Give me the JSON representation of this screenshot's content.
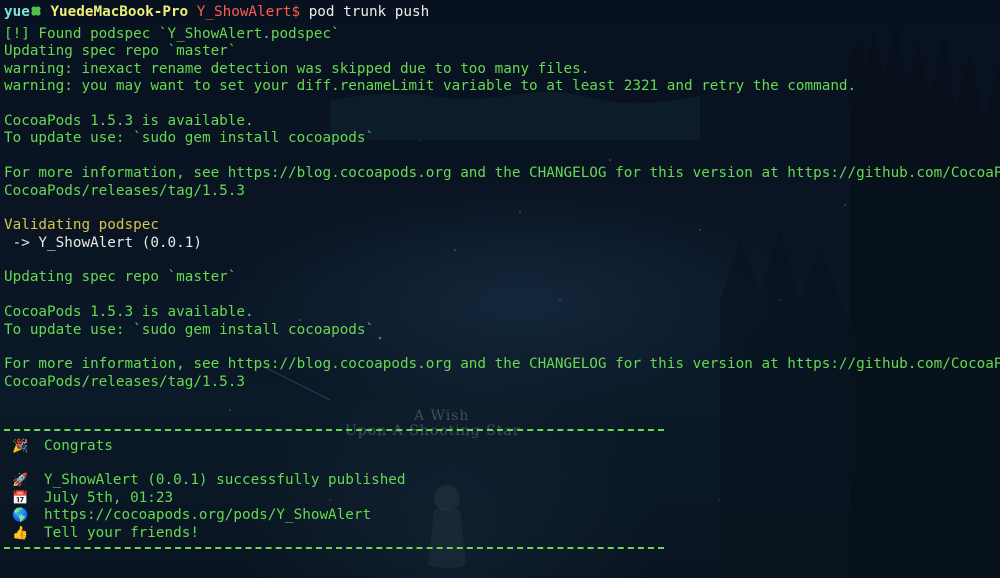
{
  "prompt": {
    "user": "yue",
    "host": "YuedeMacBook-Pro",
    "path": "Y_ShowAlert",
    "dollar": "$",
    "command": "pod trunk push"
  },
  "output": {
    "found": "[!] Found podspec `Y_ShowAlert.podspec`",
    "updating1": "Updating spec repo `master`",
    "warn1": "warning: inexact rename detection was skipped due to too many files.",
    "warn2": "warning: you may want to set your diff.renameLimit variable to at least 2321 and retry the command.",
    "available1": "CocoaPods 1.5.3 is available.",
    "update_cmd1": "To update use: `sudo gem install cocoapods`",
    "info1_a": "For more information, see https://blog.cocoapods.org and the CHANGELOG for this version at https://github.com/CocoaPods/",
    "info1_b": "CocoaPods/releases/tag/1.5.3",
    "validating": "Validating podspec",
    "validating_pod": " -> Y_ShowAlert (0.0.1)",
    "updating2": "Updating spec repo `master`",
    "available2": "CocoaPods 1.5.3 is available.",
    "update_cmd2": "To update use: `sudo gem install cocoapods`",
    "info2_a": "For more information, see https://blog.cocoapods.org and the CHANGELOG for this version at https://github.com/CocoaPods/",
    "info2_b": "CocoaPods/releases/tag/1.5.3"
  },
  "congrats": {
    "title": "Congrats",
    "published": "Y_ShowAlert (0.0.1) successfully published",
    "date": "July 5th, 01:23",
    "url": "https://cocoapods.org/pods/Y_ShowAlert",
    "tell": "Tell your friends!",
    "icons": {
      "title": "party-popper-icon",
      "published": "rocket-icon",
      "date": "calendar-icon",
      "url": "globe-icon",
      "tell": "thumbs-up-icon"
    },
    "glyphs": {
      "title": "🎉",
      "published": "🚀",
      "date": "📅",
      "url": "🌎",
      "tell": "👍"
    }
  },
  "wallpaper": {
    "line1": "A Wish",
    "line2": "Upon A Shooting Star"
  },
  "colors": {
    "output_green": "#66d950",
    "validating_yellow": "#d8c44a",
    "prompt_user": "#7fe0e0",
    "prompt_host": "#eef07a",
    "prompt_path": "#ff5e4e"
  }
}
